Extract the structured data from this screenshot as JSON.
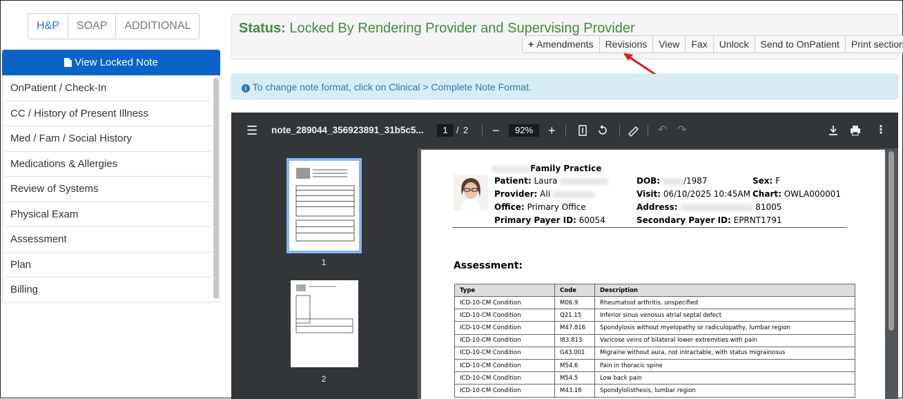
{
  "tabs": [
    "H&P",
    "SOAP",
    "ADDITIONAL"
  ],
  "sidebar": {
    "view_locked_note": "View Locked Note",
    "items": [
      "OnPatient / Check-In",
      "CC / History of Present Illness",
      "Med / Fam / Social History",
      "Medications & Allergies",
      "Review of Systems",
      "Physical Exam",
      "Assessment",
      "Plan",
      "Billing"
    ]
  },
  "status": {
    "label": "Status:",
    "value": "Locked By Rendering Provider and Supervising Provider",
    "buttons": {
      "amendments": "Amendments",
      "revisions": "Revisions",
      "view": "View",
      "fax": "Fax",
      "unlock": "Unlock",
      "send": "Send to OnPatient",
      "print": "Print sections"
    }
  },
  "info": "To change note format, click on Clinical > Complete Note Format.",
  "viewer": {
    "filename": "note_289044_356923891_31b5c5...",
    "current_page": "1",
    "page_sep": "/",
    "total_pages": "2",
    "zoom": "92%",
    "thumb_labels": [
      "1",
      "2"
    ]
  },
  "document": {
    "practice": "Family Practice",
    "patient_label": "Patient:",
    "patient_value": "Laura",
    "provider_label": "Provider:",
    "provider_value": "Ali",
    "office_label": "Office:",
    "office_value": "Primary Office",
    "payer_label": "Primary Payer ID:",
    "payer_value": "60054",
    "dob_label": "DOB:",
    "dob_value": "/1987",
    "visit_label": "Visit:",
    "visit_value": "06/10/2025 10:45AM",
    "address_label": "Address:",
    "address_value": "81005",
    "sec_payer_label": "Secondary Payer ID:",
    "sec_payer_value": "EPRNT1791",
    "sex_label": "Sex:",
    "sex_value": "F",
    "chart_label": "Chart:",
    "chart_value": "OWLA000001",
    "assessment_title": "Assessment:",
    "table": {
      "headers": [
        "Type",
        "Code",
        "Description"
      ],
      "rows": [
        [
          "ICD-10-CM Condition",
          "M06.9",
          "Rheumatoid arthritis, unspecified"
        ],
        [
          "ICD-10-CM Condition",
          "Q21.15",
          "Inferior sinus venosus atrial septal defect"
        ],
        [
          "ICD-10-CM Condition",
          "M47.816",
          "Spondylosis without myelopathy or radiculopathy, lumbar region"
        ],
        [
          "ICD-10-CM Condition",
          "I83.813",
          "Varicose veins of bilateral lower extremities with pain"
        ],
        [
          "ICD-10-CM Condition",
          "G43.001",
          "Migraine without aura, not intractable, with status migrainosus"
        ],
        [
          "ICD-10-CM Condition",
          "M54.6",
          "Pain in thoracic spine"
        ],
        [
          "ICD-10-CM Condition",
          "M54.5",
          "Low back pain"
        ],
        [
          "ICD-10-CM Condition",
          "M43.16",
          "Spondylolisthesis, lumbar region"
        ]
      ]
    }
  },
  "colors": {
    "primary": "#0a64c8",
    "status_green": "#3c8d3c",
    "info_bg": "#d7ecf5",
    "arrow": "#e0191b"
  }
}
